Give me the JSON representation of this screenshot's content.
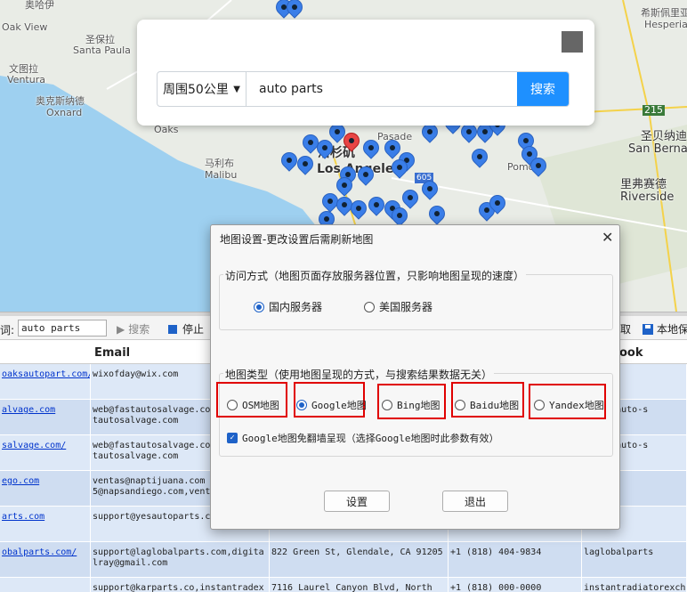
{
  "map": {
    "labels": {
      "simi": "奥哈伊",
      "oak_view": "Oak View",
      "santa_paula_cn": "圣保拉",
      "santa_paula": "Santa Paula",
      "ventura_cn": "文图拉",
      "ventura": "Ventura",
      "oxnard_cn": "奥克斯纳德",
      "oxnard": "Oxnard",
      "oaks": "Oaks",
      "malibu_cn": "马利布",
      "malibu": "Malibu",
      "la_cn": "洛杉矶",
      "la": "Los Angeles",
      "pasadena": "Pasade",
      "pomona": "Pomo",
      "hesperia_cn": "希斯佩里亚",
      "hesperia": "Hesperia",
      "sb_cn": "圣贝纳迪",
      "sb": "San Berna",
      "riverside_cn": "里弗赛德",
      "riverside": "Riverside",
      "hwy": "215",
      "hwy_605": "605"
    }
  },
  "search": {
    "range": "周围50公里",
    "query": "auto parts",
    "button": "搜索"
  },
  "toolbar": {
    "label": "词:",
    "input": "auto parts",
    "search": "搜索",
    "stop": "停止",
    "take": "取",
    "local": "本地保"
  },
  "table": {
    "headers": [
      "",
      "Email",
      "",
      "",
      "ook"
    ],
    "rows": [
      [
        "oaksautopart.com/",
        "wixofday@wix.com",
        "",
        "",
        ""
      ],
      [
        "alvage.com",
        "web@fastautosalvage.com\ntautosalvage.com",
        "",
        "",
        "reign-auto-s"
      ],
      [
        "salvage.com/",
        "web@fastautosalvage.com\ntautosalvage.com",
        "",
        "",
        "reign-auto-s"
      ],
      [
        "ego.com",
        "ventas@naptijuana.com\n5@napsandiego.com,vent",
        "",
        "",
        ""
      ],
      [
        "arts.com",
        "support@yesautoparts.com",
        "",
        "",
        "k,wix"
      ],
      [
        "obalparts.com/",
        "support@laglobalparts.com,digita\nlray@gmail.com",
        "822 Green St, Glendale, CA 91205",
        "+1 (818) 404-9834",
        "laglobalparts"
      ],
      [
        "",
        "support@karparts.co,instantradex",
        "7116 Laurel Canyon Blvd, North",
        "+1 (818) 000-0000",
        "instantradiatorexch"
      ]
    ]
  },
  "dialog": {
    "title": "地图设置-更改设置后需刷新地图",
    "access_legend": "访问方式（地图页面存放服务器位置，只影响地图呈现的速度）",
    "server_cn": "国内服务器",
    "server_us": "美国服务器",
    "type_legend": "地图类型（使用地图呈现的方式，与搜索结果数据无关）",
    "types": [
      "OSM地图",
      "Google地图",
      "Bing地图",
      "Baidu地图",
      "Yandex地图"
    ],
    "selected_type": "Google地图",
    "selected_server": "国内服务器",
    "checkbox": "Google地图免翻墙呈现（选择Google地图时此参数有效）",
    "ok": "设置",
    "exit": "退出"
  }
}
